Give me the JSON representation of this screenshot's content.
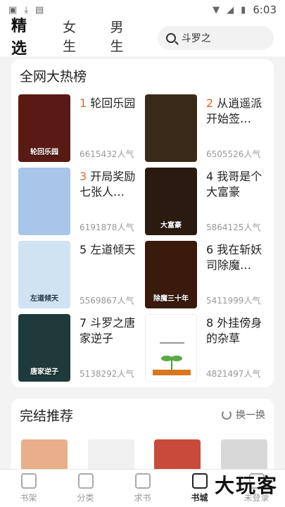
{
  "status_bar": {
    "time": "6:03"
  },
  "nav": {
    "tabs": [
      {
        "label": "精选"
      },
      {
        "label": "女生"
      },
      {
        "label": "男生"
      }
    ],
    "search_text": "斗罗之"
  },
  "hot_list": {
    "title": "全网大热榜",
    "items": [
      {
        "rank": "1",
        "title": "轮回乐园",
        "popularity": "6615432人气",
        "cover_text": "轮回乐园",
        "cover_color": "#5a1a14"
      },
      {
        "rank": "2",
        "title": "从逍遥派开始签…",
        "popularity": "6505526人气",
        "cover_text": "",
        "cover_color": "#3a2a1a"
      },
      {
        "rank": "3",
        "title": "开局奖励七张人…",
        "popularity": "6191878人气",
        "cover_text": "",
        "cover_color": "#a8c7e8"
      },
      {
        "rank": "4",
        "title": "我哥是个大富豪",
        "popularity": "5864125人气",
        "cover_text": "大富豪",
        "cover_color": "#2a1a10"
      },
      {
        "rank": "5",
        "title": "左道倾天",
        "popularity": "5569867人气",
        "cover_text": "左道倾天",
        "cover_color": "#cfe3f3"
      },
      {
        "rank": "6",
        "title": "我在斩妖司除魔…",
        "popularity": "5411999人气",
        "cover_text": "除魔三十年",
        "cover_color": "#3a1a0c"
      },
      {
        "rank": "7",
        "title": "斗罗之唐家逆子",
        "popularity": "5138292人气",
        "cover_text": "唐家逆子",
        "cover_color": "#1e3a3a"
      },
      {
        "rank": "8",
        "title": "外挂傍身的杂草",
        "popularity": "4821497人气",
        "cover_text": "",
        "cover_color": "#ffffff"
      }
    ]
  },
  "completed": {
    "title": "完结推荐",
    "refresh_label": "换一换",
    "cover_colors": [
      "#e8b08a",
      "#f0f0f0",
      "#c94a3a",
      "#d8d8d8"
    ]
  },
  "bottom_nav": [
    {
      "label": "书架"
    },
    {
      "label": "分类"
    },
    {
      "label": "求书"
    },
    {
      "label": "书城"
    },
    {
      "label": "未登录"
    }
  ],
  "watermark": "大玩客"
}
